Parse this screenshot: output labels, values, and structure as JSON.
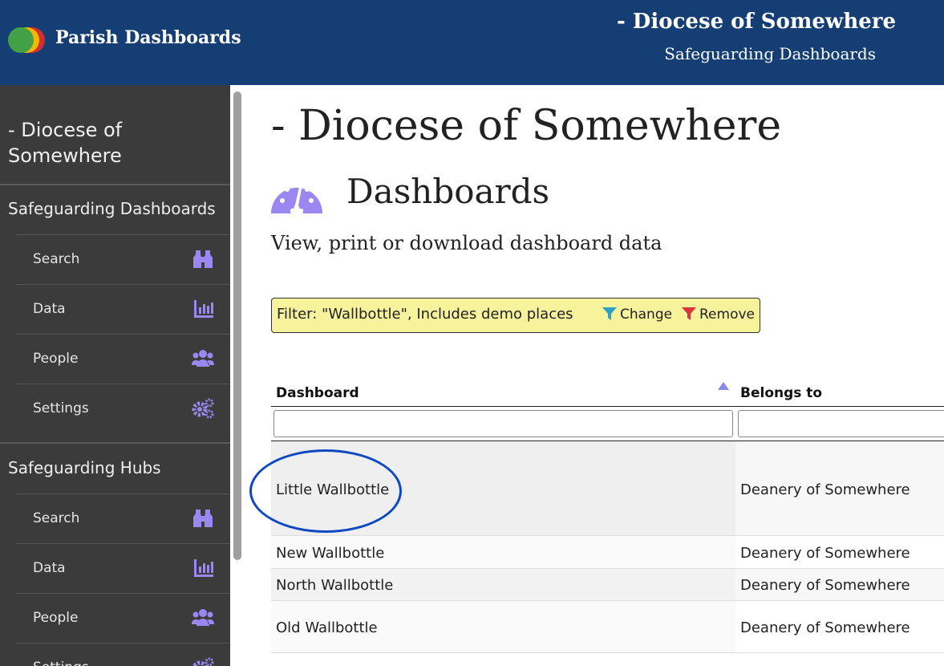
{
  "header": {
    "app_title": "Parish Dashboards",
    "diocese_title": "- Diocese of Somewhere",
    "diocese_subtitle": "Safeguarding Dashboards"
  },
  "sidebar": {
    "diocese": "- Diocese of Somewhere",
    "sections": [
      {
        "title": "Safeguarding Dashboards",
        "items": [
          {
            "label": "Search",
            "icon": "binoculars-icon"
          },
          {
            "label": "Data",
            "icon": "chart-icon"
          },
          {
            "label": "People",
            "icon": "users-icon"
          },
          {
            "label": "Settings",
            "icon": "cogs-icon"
          }
        ]
      },
      {
        "title": "Safeguarding Hubs",
        "items": [
          {
            "label": "Search",
            "icon": "binoculars-icon"
          },
          {
            "label": "Data",
            "icon": "chart-icon"
          },
          {
            "label": "People",
            "icon": "users-icon"
          },
          {
            "label": "Settings",
            "icon": "cogs-icon"
          }
        ]
      }
    ]
  },
  "main": {
    "page_title": "- Diocese of Somewhere",
    "heading": "Dashboards",
    "description": "View, print or download dashboard data",
    "filter": {
      "text": "Filter: \"Wallbottle\", Includes demo places",
      "change_label": "Change",
      "remove_label": "Remove"
    },
    "table": {
      "columns": [
        "Dashboard",
        "Belongs to"
      ],
      "rows": [
        {
          "dashboard": "Little Wallbottle",
          "belongs_to": "Deanery of Somewhere"
        },
        {
          "dashboard": "New Wallbottle",
          "belongs_to": "Deanery of Somewhere"
        },
        {
          "dashboard": "North Wallbottle",
          "belongs_to": "Deanery of Somewhere"
        },
        {
          "dashboard": "Old Wallbottle",
          "belongs_to": "Deanery of Somewhere"
        }
      ]
    }
  },
  "colors": {
    "header_bg": "#153f74",
    "sidebar_bg": "#3b3b3b",
    "icon_accent": "#9b87f0",
    "filter_bg": "#f7f39c",
    "change_icon": "#2aa4c2",
    "remove_icon": "#d9333f",
    "highlight_circle": "#0c49c2"
  }
}
